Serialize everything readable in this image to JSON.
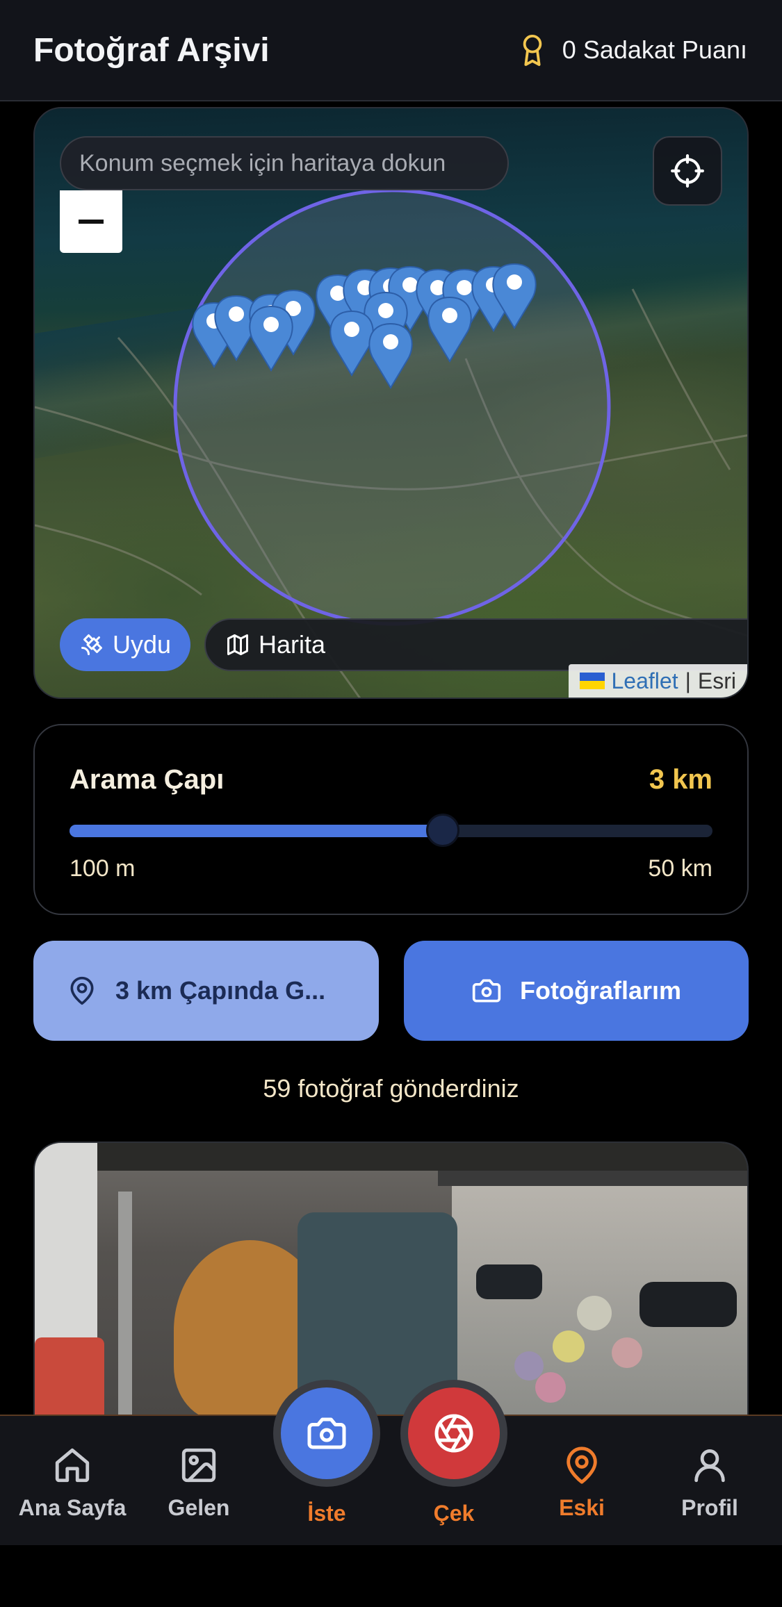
{
  "header": {
    "title": "Fotoğraf Arşivi",
    "loyalty_label": "0 Sadakat Puanı"
  },
  "map": {
    "search_placeholder": "Konum seçmek için haritaya dokun",
    "layers": {
      "satellite": "Uydu",
      "map": "Harita",
      "active": "satellite"
    },
    "attribution": {
      "leaflet": "Leaflet",
      "separator": "|",
      "provider": "Esri"
    }
  },
  "radius": {
    "label": "Arama Çapı",
    "value": "3 km",
    "min_label": "100 m",
    "max_label": "50 km",
    "slider_fraction": 0.58
  },
  "actions": {
    "nearby_label": "3 km Çapında G...",
    "my_photos_label": "Fotoğraflarım"
  },
  "stats": {
    "sent_text": "59 fotoğraf gönderdiniz"
  },
  "nav": {
    "home": "Ana Sayfa",
    "incoming": "Gelen",
    "request": "İste",
    "shoot": "Çek",
    "old": "Eski",
    "profile": "Profil",
    "active": "old"
  },
  "colors": {
    "accent_blue": "#4a76e0",
    "accent_orange": "#f07c2c",
    "accent_gold": "#f2c64f",
    "shoot_red": "#d0393b"
  },
  "icons": [
    "award-icon",
    "crosshair-icon",
    "satellite-icon",
    "map-icon",
    "map-pin-icon",
    "camera-icon",
    "home-icon",
    "image-icon",
    "aperture-icon",
    "user-icon"
  ]
}
